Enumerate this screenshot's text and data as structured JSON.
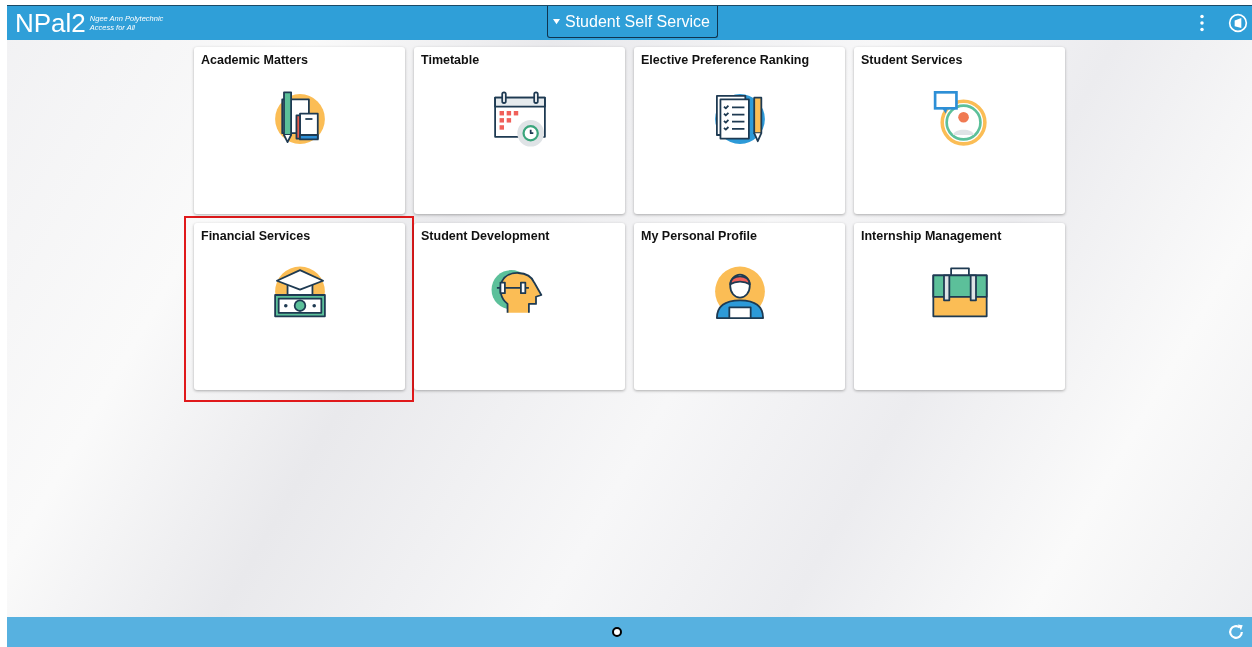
{
  "header": {
    "logo": {
      "mark": "NPal2",
      "line_1": "Ngee Ann Polytechnic",
      "line_2": "Access for All"
    },
    "title": "Student Self Service"
  },
  "tiles": [
    {
      "label": "Academic Matters",
      "kind": "books",
      "highlighted": false
    },
    {
      "label": "Timetable",
      "kind": "calendar",
      "highlighted": false
    },
    {
      "label": "Elective Preference Ranking",
      "kind": "checklist",
      "highlighted": false
    },
    {
      "label": "Student Services",
      "kind": "support",
      "highlighted": false
    },
    {
      "label": "Financial Services",
      "kind": "money",
      "highlighted": true
    },
    {
      "label": "Student Development",
      "kind": "head",
      "highlighted": false
    },
    {
      "label": "My Personal Profile",
      "kind": "person",
      "highlighted": false
    },
    {
      "label": "Internship Management",
      "kind": "briefcase",
      "highlighted": false
    }
  ],
  "pages": [
    {
      "selected": true
    }
  ]
}
